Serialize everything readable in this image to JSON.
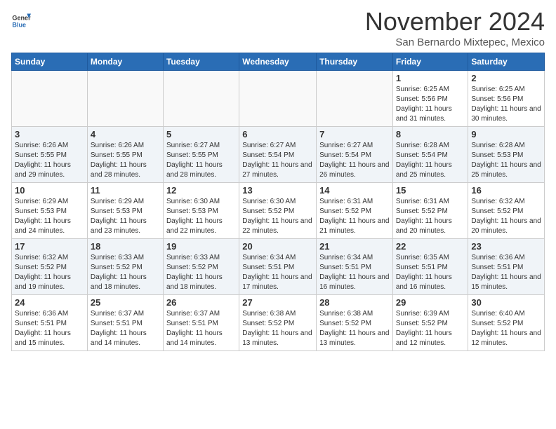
{
  "logo": {
    "line1": "General",
    "line2": "Blue",
    "icon_color": "#2a6db5"
  },
  "title": "November 2024",
  "subtitle": "San Bernardo Mixtepec, Mexico",
  "weekdays": [
    "Sunday",
    "Monday",
    "Tuesday",
    "Wednesday",
    "Thursday",
    "Friday",
    "Saturday"
  ],
  "weeks": [
    [
      {
        "day": "",
        "info": ""
      },
      {
        "day": "",
        "info": ""
      },
      {
        "day": "",
        "info": ""
      },
      {
        "day": "",
        "info": ""
      },
      {
        "day": "",
        "info": ""
      },
      {
        "day": "1",
        "info": "Sunrise: 6:25 AM\nSunset: 5:56 PM\nDaylight: 11 hours and 31 minutes."
      },
      {
        "day": "2",
        "info": "Sunrise: 6:25 AM\nSunset: 5:56 PM\nDaylight: 11 hours and 30 minutes."
      }
    ],
    [
      {
        "day": "3",
        "info": "Sunrise: 6:26 AM\nSunset: 5:55 PM\nDaylight: 11 hours and 29 minutes."
      },
      {
        "day": "4",
        "info": "Sunrise: 6:26 AM\nSunset: 5:55 PM\nDaylight: 11 hours and 28 minutes."
      },
      {
        "day": "5",
        "info": "Sunrise: 6:27 AM\nSunset: 5:55 PM\nDaylight: 11 hours and 28 minutes."
      },
      {
        "day": "6",
        "info": "Sunrise: 6:27 AM\nSunset: 5:54 PM\nDaylight: 11 hours and 27 minutes."
      },
      {
        "day": "7",
        "info": "Sunrise: 6:27 AM\nSunset: 5:54 PM\nDaylight: 11 hours and 26 minutes."
      },
      {
        "day": "8",
        "info": "Sunrise: 6:28 AM\nSunset: 5:54 PM\nDaylight: 11 hours and 25 minutes."
      },
      {
        "day": "9",
        "info": "Sunrise: 6:28 AM\nSunset: 5:53 PM\nDaylight: 11 hours and 25 minutes."
      }
    ],
    [
      {
        "day": "10",
        "info": "Sunrise: 6:29 AM\nSunset: 5:53 PM\nDaylight: 11 hours and 24 minutes."
      },
      {
        "day": "11",
        "info": "Sunrise: 6:29 AM\nSunset: 5:53 PM\nDaylight: 11 hours and 23 minutes."
      },
      {
        "day": "12",
        "info": "Sunrise: 6:30 AM\nSunset: 5:53 PM\nDaylight: 11 hours and 22 minutes."
      },
      {
        "day": "13",
        "info": "Sunrise: 6:30 AM\nSunset: 5:52 PM\nDaylight: 11 hours and 22 minutes."
      },
      {
        "day": "14",
        "info": "Sunrise: 6:31 AM\nSunset: 5:52 PM\nDaylight: 11 hours and 21 minutes."
      },
      {
        "day": "15",
        "info": "Sunrise: 6:31 AM\nSunset: 5:52 PM\nDaylight: 11 hours and 20 minutes."
      },
      {
        "day": "16",
        "info": "Sunrise: 6:32 AM\nSunset: 5:52 PM\nDaylight: 11 hours and 20 minutes."
      }
    ],
    [
      {
        "day": "17",
        "info": "Sunrise: 6:32 AM\nSunset: 5:52 PM\nDaylight: 11 hours and 19 minutes."
      },
      {
        "day": "18",
        "info": "Sunrise: 6:33 AM\nSunset: 5:52 PM\nDaylight: 11 hours and 18 minutes."
      },
      {
        "day": "19",
        "info": "Sunrise: 6:33 AM\nSunset: 5:52 PM\nDaylight: 11 hours and 18 minutes."
      },
      {
        "day": "20",
        "info": "Sunrise: 6:34 AM\nSunset: 5:51 PM\nDaylight: 11 hours and 17 minutes."
      },
      {
        "day": "21",
        "info": "Sunrise: 6:34 AM\nSunset: 5:51 PM\nDaylight: 11 hours and 16 minutes."
      },
      {
        "day": "22",
        "info": "Sunrise: 6:35 AM\nSunset: 5:51 PM\nDaylight: 11 hours and 16 minutes."
      },
      {
        "day": "23",
        "info": "Sunrise: 6:36 AM\nSunset: 5:51 PM\nDaylight: 11 hours and 15 minutes."
      }
    ],
    [
      {
        "day": "24",
        "info": "Sunrise: 6:36 AM\nSunset: 5:51 PM\nDaylight: 11 hours and 15 minutes."
      },
      {
        "day": "25",
        "info": "Sunrise: 6:37 AM\nSunset: 5:51 PM\nDaylight: 11 hours and 14 minutes."
      },
      {
        "day": "26",
        "info": "Sunrise: 6:37 AM\nSunset: 5:51 PM\nDaylight: 11 hours and 14 minutes."
      },
      {
        "day": "27",
        "info": "Sunrise: 6:38 AM\nSunset: 5:52 PM\nDaylight: 11 hours and 13 minutes."
      },
      {
        "day": "28",
        "info": "Sunrise: 6:38 AM\nSunset: 5:52 PM\nDaylight: 11 hours and 13 minutes."
      },
      {
        "day": "29",
        "info": "Sunrise: 6:39 AM\nSunset: 5:52 PM\nDaylight: 11 hours and 12 minutes."
      },
      {
        "day": "30",
        "info": "Sunrise: 6:40 AM\nSunset: 5:52 PM\nDaylight: 11 hours and 12 minutes."
      }
    ]
  ]
}
